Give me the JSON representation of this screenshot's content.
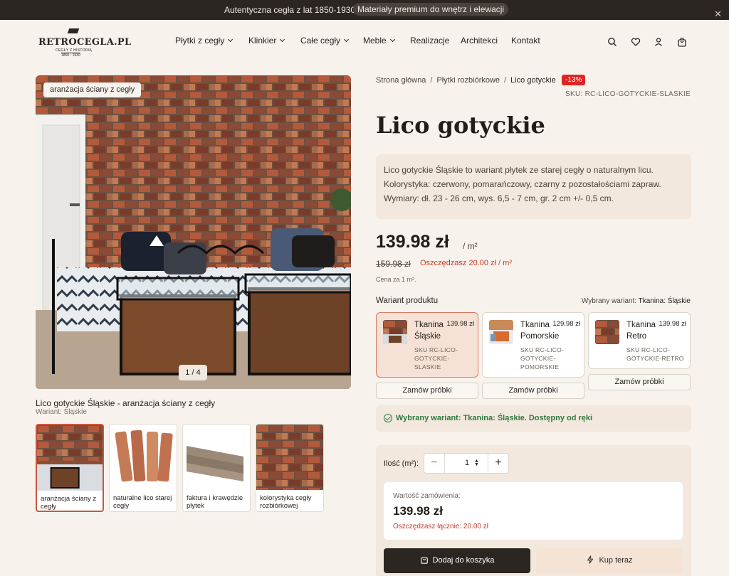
{
  "topbar": {
    "text": "Autentyczna cegła z lat 1850-1930",
    "pill": "Materiały premium do wnętrz i elewacji",
    "close_icon": "close-icon"
  },
  "header": {
    "logo": {
      "word": "RETROCEGLA.PL",
      "tagline": "CEGŁY Z HISTORIĄ",
      "years": "1850 - 1930"
    },
    "nav": [
      "Płytki z cegły",
      "Klinkier",
      "Całe cegły",
      "Meble",
      "Realizacje",
      "Architekci",
      "Kontakt"
    ],
    "icons": [
      "search-icon",
      "heart-icon",
      "user-icon",
      "bag-icon"
    ]
  },
  "gallery": {
    "chip": "aranżacja ściany z cegły",
    "counter": "1 / 4",
    "caption": "Lico gotyckie Śląskie - aranżacja ściany z cegły",
    "caption_variant": "Wariant: Śląskie",
    "thumbs": [
      {
        "label": "aranżacja ściany z cegły"
      },
      {
        "label": "naturalne lico starej cegły"
      },
      {
        "label": "faktura i krawędzie płytek"
      },
      {
        "label": "kolorystyka cegły rozbiórkowej"
      }
    ]
  },
  "product": {
    "breadcrumb": [
      "Strona główna",
      "Płytki rozbiórkowe",
      "Lico gotyckie"
    ],
    "breadcrumb_sep": "/",
    "sale_badge": "-13%",
    "sku": "SKU: RC-LICO-GOTYCKIE-SLASKIE",
    "title": "Lico gotyckie",
    "description": "Lico gotyckie Śląskie to wariant płytek ze starej cegły o naturalnym licu. Kolorystyka: czerwony, pomarańczowy, czarny z pozostałościami zapraw. Wymiary: dł. 23 - 26 cm, wys. 6,5 - 7 cm, gr. 2 cm +/- 0,5 cm.",
    "price": "139.98 zł",
    "unit": "/ m²",
    "old_price": "159.98 zł",
    "save": "Oszczędzasz 20.00 zł / m²",
    "per": "Cena za 1 m².",
    "variant_label": "Wariant produktu",
    "variant_selected_prefix": "Wybrany wariant:",
    "variant_selected_value": "Tkanina: Śląskie",
    "variants": [
      {
        "name": "Tkanina Śląskie",
        "price": "139.98 zł",
        "sku": "SKU RC-LICO-GOTYCKIE-SLASKIE",
        "active": true
      },
      {
        "name": "Tkanina Pomorskie",
        "price": "129.98 zł",
        "sku": "SKU RC-LICO-GOTYCKIE-POMORSKIE",
        "active": false
      },
      {
        "name": "Tkanina Retro",
        "price": "139.98 zł",
        "sku": "SKU RC-LICO-GOTYCKIE-RETRO",
        "active": false
      }
    ],
    "sample_label": "Zamów próbki",
    "availability": "Wybrany wariant: Tkanina: Śląskie. Dostępny od ręki"
  },
  "buy": {
    "qty_label": "Ilość (m²):",
    "qty_value": "1",
    "order_label": "Wartość zamówienia:",
    "order_value": "139.98 zł",
    "order_save": "Oszczędzasz łącznie: 20.00 zł",
    "add_to_cart": "Dodaj do koszyka",
    "buy_now": "Kup teraz"
  },
  "colors": {
    "accent": "#2b2622",
    "sale": "#e02424",
    "save": "#c73a2a",
    "available": "#2f7a3e",
    "panel": "#f2e8dd"
  }
}
